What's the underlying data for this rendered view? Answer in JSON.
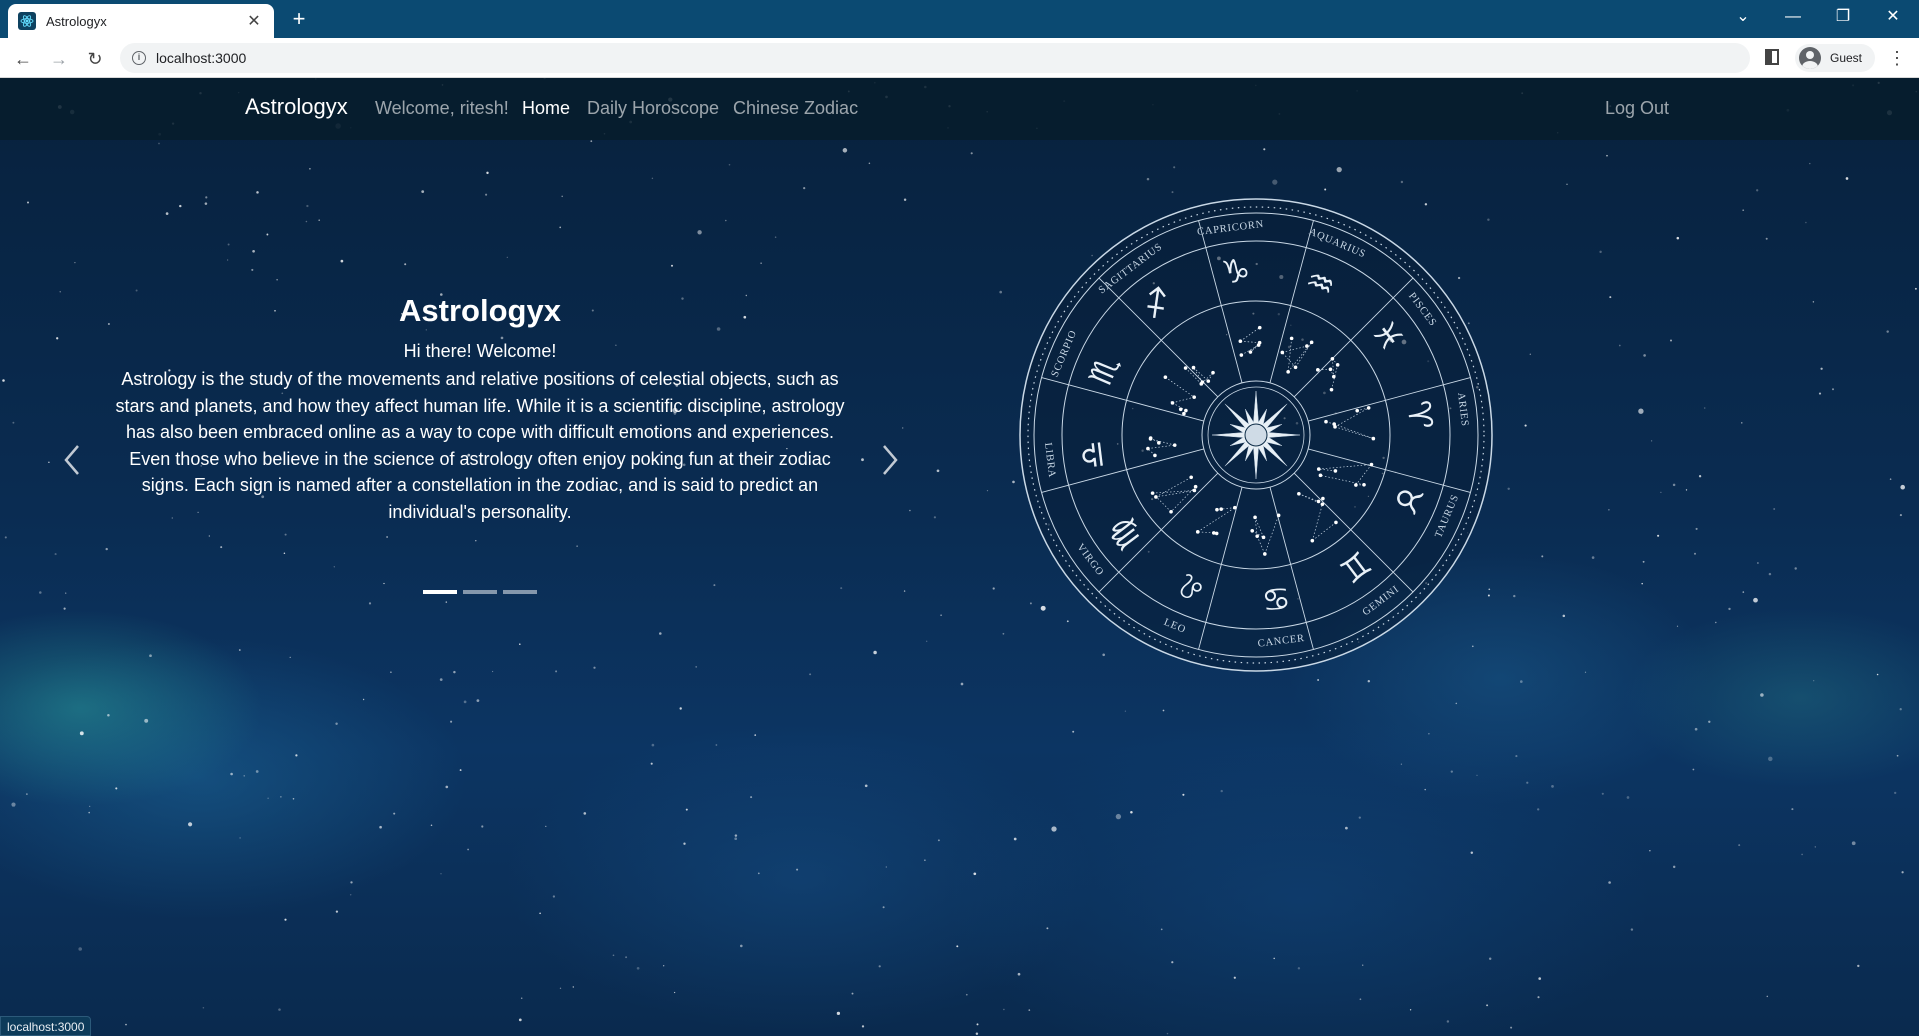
{
  "browser": {
    "tab_title": "Astrologyx",
    "url": "localhost:3000",
    "profile_label": "Guest",
    "status_url": "localhost:3000"
  },
  "navbar": {
    "brand": "Astrologyx",
    "welcome": "Welcome, ritesh!",
    "links": [
      "Home",
      "Daily Horoscope",
      "Chinese Zodiac"
    ],
    "logout": "Log Out"
  },
  "carousel": {
    "title": "Astrologyx",
    "subtitle": "Hi there! Welcome!",
    "text": "Astrology is the study of the movements and relative positions of celestial objects, such as stars and planets, and how they affect human life. While it is a scientific discipline, astrology has also been embraced online as a way to cope with difficult emotions and experiences. Even those who believe in the science of astrology often enjoy poking fun at their zodiac signs. Each sign is named after a constellation in the zodiac, and is said to predict an individual's personality.",
    "slide_count": 3,
    "active_slide": 1
  },
  "zodiac_wheel": {
    "signs": [
      "CAPRICORN",
      "AQUARIUS",
      "PISCES",
      "ARIES",
      "TAURUS",
      "GEMINI",
      "CANCER",
      "LEO",
      "VIRGO",
      "LIBRA",
      "SCORPIO",
      "SAGITTARIUS"
    ],
    "symbols": [
      "♑",
      "♒",
      "♓",
      "♈",
      "♉",
      "♊",
      "♋",
      "♌",
      "♍",
      "♎",
      "♏",
      "♐"
    ]
  },
  "colors": {
    "navbar_bg": "#061c2c",
    "tab_strip": "#0b4a72",
    "wheel_stroke": "#c9d8e6"
  }
}
